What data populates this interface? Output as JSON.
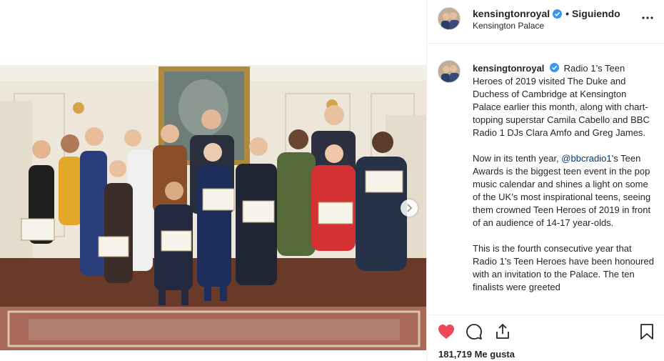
{
  "header": {
    "username": "kensingtonroyal",
    "separator": "•",
    "follow_label": "Siguiendo",
    "location": "Kensington Palace"
  },
  "caption": {
    "username": "kensingtonroyal",
    "paragraph1": "Radio 1’s Teen Heroes of 2019 visited The Duke and Duchess of Cambridge at Kensington Palace earlier this month, along with chart-topping superstar Camila Cabello and BBC Radio 1 DJs Clara Amfo and Greg James.",
    "paragraph2_before": "Now in its tenth year, ",
    "paragraph2_mention": "@bbcradio1",
    "paragraph2_after": "’s Teen Awards is the biggest teen event in the pop music calendar and shines a light on some of the UK’s most inspirational teens, seeing them crowned Teen Heroes of 2019 in front of an audience of 14-17 year-olds.",
    "paragraph3": "This is the fourth consecutive year that Radio 1’s Teen Heroes have been honoured with an invitation to the Palace. The ten finalists were greeted"
  },
  "actions": {
    "likes": "181,719 Me gusta",
    "liked": true,
    "like_color": "#ed4956"
  },
  "icons": {
    "verified": "verified-badge-icon",
    "more": "more-options-icon",
    "like": "heart-icon",
    "comment": "comment-icon",
    "share": "share-icon",
    "save": "bookmark-icon",
    "next": "chevron-right-icon"
  },
  "colors": {
    "verified": "#3897f0",
    "mention": "#00376b",
    "divider": "#efefef"
  }
}
